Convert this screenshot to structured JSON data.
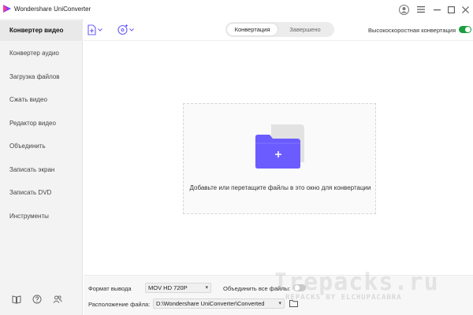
{
  "app": {
    "title": "Wondershare UniConverter"
  },
  "colors": {
    "accent": "#6a5cff",
    "toggle_on": "#1a9e3e",
    "toggle_off": "#c9c9c9",
    "folder": "#6a5cff"
  },
  "sidebar": {
    "items": [
      {
        "label": "Конвертер видео",
        "active": true
      },
      {
        "label": "Конвертер аудио"
      },
      {
        "label": "Загрузка файлов"
      },
      {
        "label": "Сжать видео"
      },
      {
        "label": "Редактор видео"
      },
      {
        "label": "Объединить"
      },
      {
        "label": "Записать экран"
      },
      {
        "label": "Записать DVD"
      },
      {
        "label": "Инструменты"
      }
    ],
    "footer_icons": [
      "book-icon",
      "help-icon",
      "users-icon"
    ]
  },
  "toolbar": {
    "tabs": [
      {
        "label": "Конвертация",
        "active": true
      },
      {
        "label": "Завершено"
      }
    ],
    "high_speed_label": "Высокоскоростная конвертация",
    "high_speed_on": true
  },
  "dropzone": {
    "text": "Добавьте или перетащите файлы в это окно для конвертации"
  },
  "bottom": {
    "output_format_label": "Формат вывода",
    "output_format_value": "MOV HD 720P",
    "merge_label": "Объединить все файлы:",
    "merge_on": false,
    "location_label": "Расположение файла:",
    "location_value": "D:\\Wondershare UniConverter\\Converted"
  },
  "watermark": {
    "text": "Irepacks.ru",
    "subtext": "REPACKS BY ELCHUPACABRA"
  }
}
